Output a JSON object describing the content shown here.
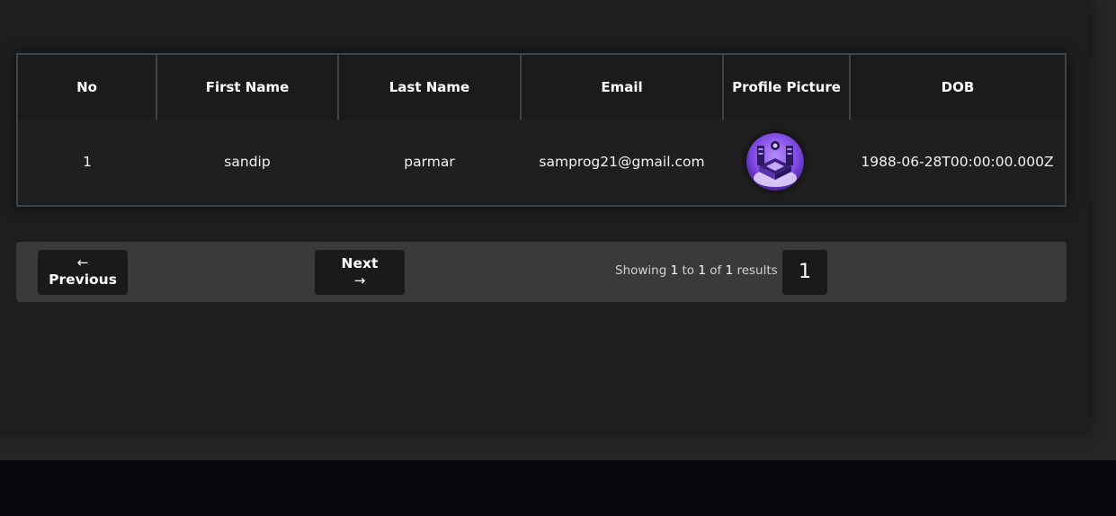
{
  "table": {
    "headers": [
      "No",
      "First Name",
      "Last Name",
      "Email",
      "Profile Picture",
      "DOB"
    ],
    "rows": [
      {
        "no": "1",
        "first_name": "sandip",
        "last_name": "parmar",
        "email": "samprog21@gmail.com",
        "dob": "1988-06-28T00:00:00.000Z"
      }
    ]
  },
  "pagination": {
    "previous_arrow": "←",
    "previous_label": "Previous",
    "next_label": "Next",
    "next_arrow": "→",
    "showing_prefix": "Showing",
    "from": "1",
    "to_word": "to",
    "to": "1",
    "of_word": "of",
    "total": "1",
    "results_word": "results",
    "current_page": "1"
  },
  "colors": {
    "accent_purple": "#8a5cf6",
    "surface": "#1e1e1e",
    "border": "#3d444b"
  },
  "icons": {
    "avatar": "isometric-tech-illustration"
  }
}
